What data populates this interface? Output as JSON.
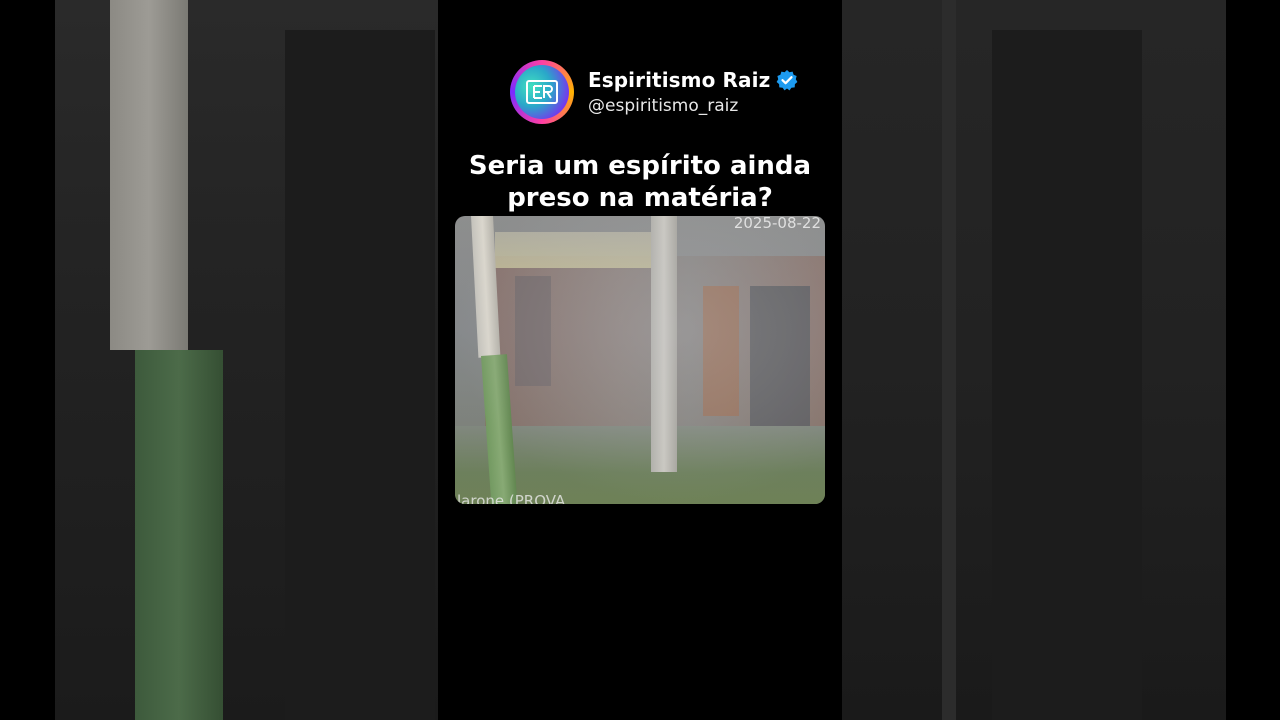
{
  "post": {
    "display_name": "Espiritismo Raiz",
    "handle": "@espiritismo_raiz",
    "verified_icon": "verified-badge-icon",
    "avatar_icon": "espiritismo-raiz-logo-icon",
    "question": "Seria um espírito ainda preso na matéria?"
  },
  "video": {
    "timestamp": "2025-08-22",
    "caption": "larone (PROVA"
  },
  "colors": {
    "background": "#000000",
    "verified": "#1d9bf0",
    "text": "#ffffff"
  }
}
